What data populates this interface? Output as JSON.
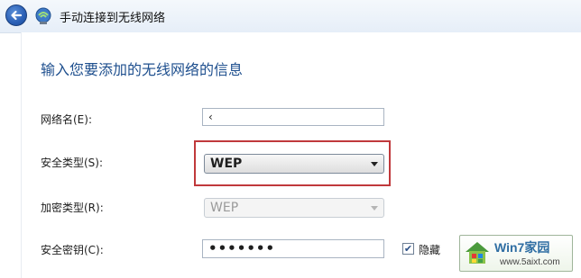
{
  "header": {
    "back_icon": "back-arrow-icon",
    "network_icon": "wireless-network-icon",
    "title": "手动连接到无线网络"
  },
  "heading": "输入您要添加的无线网络的信息",
  "fields": {
    "network_name": {
      "label": "网络名(E):",
      "value": "‹"
    },
    "security_type": {
      "label": "安全类型(S):",
      "value": "WEP"
    },
    "encryption_type": {
      "label": "加密类型(R):",
      "value": "WEP"
    },
    "security_key": {
      "label": "安全密钥(C):",
      "value": "•••••••"
    }
  },
  "hide_chars": {
    "label": "隐藏",
    "checked": true
  },
  "highlight_color": "#c0393b",
  "watermark": {
    "name": "Win7家园",
    "url": "www.5aixt.com"
  }
}
